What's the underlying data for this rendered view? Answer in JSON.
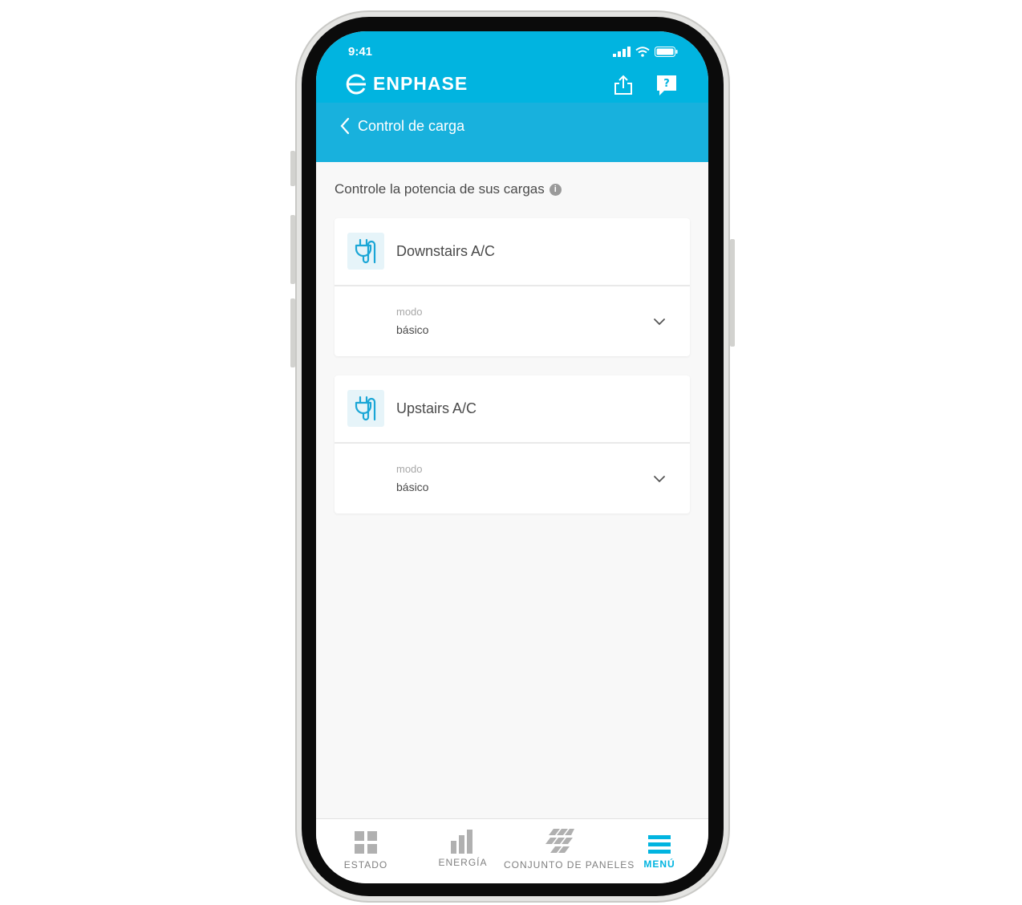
{
  "status_bar": {
    "time": "9:41"
  },
  "header": {
    "brand": "ENPHASE"
  },
  "nav": {
    "title": "Control de carga"
  },
  "section": {
    "title": "Controle la potencia de sus cargas"
  },
  "loads": [
    {
      "name": "Downstairs A/C",
      "mode_label": "modo",
      "mode_value": "básico"
    },
    {
      "name": "Upstairs A/C",
      "mode_label": "modo",
      "mode_value": "básico"
    }
  ],
  "tabs": [
    {
      "label": "ESTADO",
      "icon": "grid-icon",
      "active": false
    },
    {
      "label": "ENERGÍA",
      "icon": "bar-chart-icon",
      "active": false
    },
    {
      "label": "CONJUNTO DE PANELES",
      "icon": "panels-icon",
      "active": false
    },
    {
      "label": "MENÚ",
      "icon": "hamburger-menu-icon",
      "active": true
    }
  ],
  "colors": {
    "accent": "#01b4e0",
    "sub_header": "#18b1dd",
    "background": "#f8f8f8"
  }
}
